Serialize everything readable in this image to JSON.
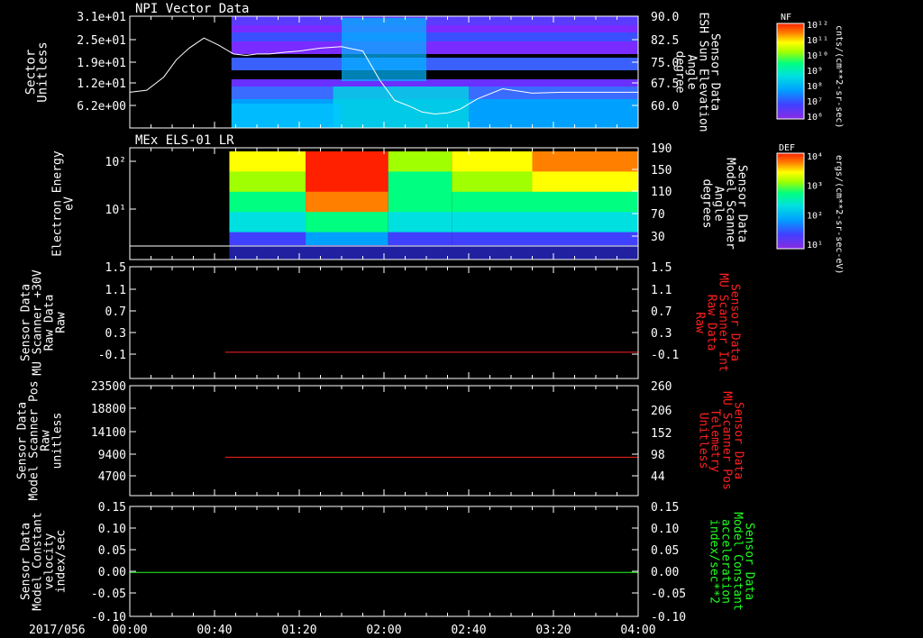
{
  "colors": {
    "frame": "#ffffff",
    "red": "#ff2020",
    "green": "#20ff20",
    "spectrogram": [
      "#8a2be2",
      "#4040ff",
      "#00a0ff",
      "#00e0e0",
      "#00ff80",
      "#a0ff00",
      "#ffff00",
      "#ff8000",
      "#ff2000"
    ]
  },
  "time_axis": {
    "date_label": "2017/056",
    "ticks": [
      "00:00",
      "00:40",
      "01:20",
      "02:00",
      "02:40",
      "03:20",
      "04:00"
    ]
  },
  "chart_data": [
    {
      "type": "heatmap",
      "title": "NPI Vector Data",
      "ylabel": "Sector\nUnitless",
      "y_ticks": [
        "3.1e+01",
        "2.5e+01",
        "1.9e+01",
        "1.2e+01",
        "6.2e+00"
      ],
      "right_ylabel": "Sensor Data\nESH Sun Elevation\nAngle\ndegree",
      "right_ticks": [
        "90.0",
        "82.5",
        "75.0",
        "67.5",
        "60.0"
      ],
      "colorbar": {
        "label": "NF",
        "units": "cnts/(cm**2-sr-sec)",
        "ticks": [
          "10¹²",
          "10¹¹",
          "10¹⁰",
          "10⁹",
          "10⁸",
          "10⁷",
          "10⁶"
        ]
      },
      "line_series": {
        "color": "#ffffff",
        "x": [
          0,
          8,
          16,
          22,
          28,
          35,
          42,
          49,
          55,
          60,
          66,
          72,
          80,
          90,
          100,
          110,
          118,
          125,
          132,
          138,
          144,
          150,
          156,
          164,
          176,
          190,
          204,
          220,
          240
        ],
        "y": [
          65.8,
          66.5,
          71,
          77,
          81,
          84.5,
          82,
          79,
          78.5,
          79,
          79,
          79.5,
          80,
          81,
          81.5,
          80,
          70,
          63,
          61,
          59,
          58.3,
          58.7,
          60,
          63.5,
          67,
          65.5,
          65.8,
          65.8,
          65.8
        ],
        "ylim": [
          53.5,
          92
        ]
      }
    },
    {
      "type": "heatmap",
      "title": "MEx ELS-01 LR",
      "ylabel": "Electron Energy\neV",
      "y_ticks": [
        "10²",
        "10¹"
      ],
      "right_ylabel": "Sensor Data\nModel Scanner\nAngle\ndegrees",
      "right_ticks": [
        "190",
        "150",
        "110",
        "70",
        "30"
      ],
      "colorbar": {
        "label": "DEF",
        "units": "ergs/(cm**2-sr-sec-eV)",
        "ticks": [
          "10⁴",
          "10³",
          "10²",
          "10¹"
        ]
      }
    },
    {
      "type": "line",
      "ylabel": "Sensor Data\nMU Scanner +30V\nRaw Data\nRaw",
      "y_ticks": [
        "1.5",
        "1.1",
        "0.7",
        "0.3",
        "-0.1"
      ],
      "right_ylabel": "Sensor Data\nMU Scanner Int\nRaw Data\nRaw",
      "right_ticks": [
        "1.5",
        "1.1",
        "0.7",
        "0.3",
        "-0.1"
      ],
      "ylim": [
        -0.5,
        1.5
      ],
      "series": [
        {
          "color": "#ff2020",
          "x": [
            45,
            240
          ],
          "y": [
            -0.03,
            -0.03
          ]
        }
      ]
    },
    {
      "type": "line",
      "ylabel": "Sensor Data\nModel Scanner Pos\nRaw\nunitless",
      "y_ticks": [
        "23500",
        "18800",
        "14100",
        "9400",
        "4700"
      ],
      "right_ylabel": "Sensor Data\nMU Scanner Pos\nTelemetry\nUnitless",
      "right_ticks": [
        "260",
        "206",
        "152",
        "98",
        "44"
      ],
      "ylim": [
        0,
        23500
      ],
      "series": [
        {
          "color": "#ff2020",
          "x": [
            45,
            240
          ],
          "y": [
            8200,
            8200
          ]
        }
      ]
    },
    {
      "type": "line",
      "ylabel": "Sensor Data\nModel Constant\nvelocity\nindex/sec",
      "y_ticks": [
        "0.15",
        "0.10",
        "0.05",
        "0.00",
        "-0.05",
        "-0.10"
      ],
      "right_ylabel": "Sensor Data\nModel Constant\nacceleration\nindex/sec**2",
      "right_ticks": [
        "0.15",
        "0.10",
        "0.05",
        "0.00",
        "-0.05",
        "-0.10"
      ],
      "ylim": [
        -0.1,
        0.15
      ],
      "series": [
        {
          "color": "#20ff20",
          "x": [
            0,
            240
          ],
          "y": [
            0,
            0
          ]
        }
      ]
    }
  ]
}
